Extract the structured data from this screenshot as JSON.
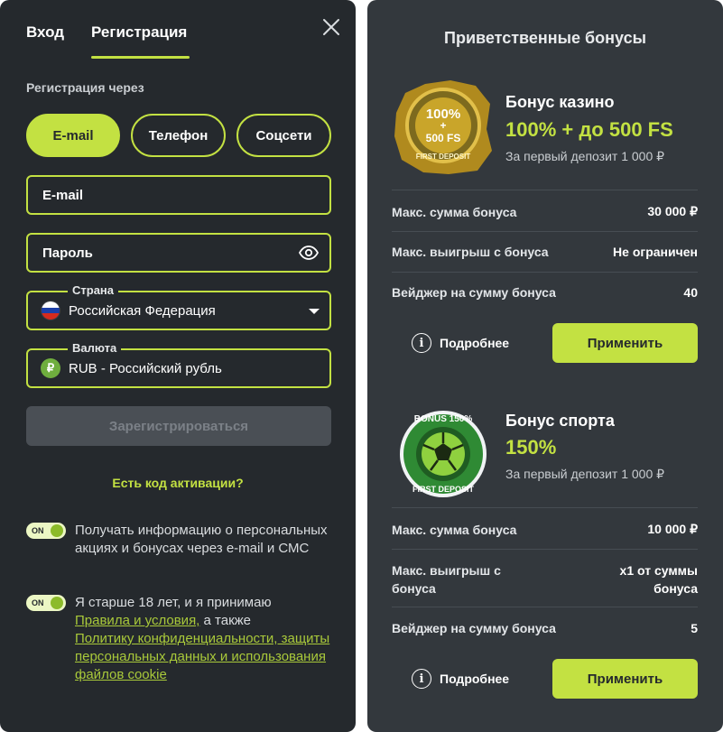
{
  "auth": {
    "tab_login": "Вход",
    "tab_register": "Регистрация",
    "register_via": "Регистрация через",
    "methods": {
      "email": "E-mail",
      "phone": "Телефон",
      "social": "Соцсети"
    },
    "email_placeholder": "E-mail",
    "password_placeholder": "Пароль",
    "country_label": "Страна",
    "country_value": "Российская Федерация",
    "currency_label": "Валюта",
    "currency_value": "RUB - Российский рубль",
    "currency_symbol": "₽",
    "register_button": "Зарегистрироваться",
    "activation_code": "Есть код активации?",
    "toggle_on": "ON",
    "consent_news": "Получать информацию о персональных акциях и бонусах через e-mail и СМС",
    "consent_age_prefix": "Я старше 18 лет, и я принимаю",
    "rules_link": "Правила и условия,",
    "also": " а также",
    "privacy_link": "Политику конфиденциальности, защиты персональных данных и использования файлов cookie"
  },
  "bonuses": {
    "title": "Приветственные бонусы",
    "casino": {
      "name": "Бонус казино",
      "value": "100% + до 500 FS",
      "subtitle": "За первый депозит 1 000 ₽",
      "badge_line1": "100%",
      "badge_line2": "+",
      "badge_line3": "500 FS",
      "badge_ribbon": "FIRST DEPOSIT",
      "rows": [
        {
          "label": "Макс. сумма бонуса",
          "value": "30 000 ₽"
        },
        {
          "label": "Макс. выигрыш с бонуса",
          "value": "Не ограничен"
        },
        {
          "label": "Вейджер на сумму бонуса",
          "value": "40"
        }
      ],
      "more": "Подробнее",
      "apply": "Применить"
    },
    "sport": {
      "name": "Бонус спорта",
      "value": "150%",
      "subtitle": "За первый депозит 1 000 ₽",
      "badge_top": "BONUS 150%",
      "badge_bottom": "FIRST DEPOSIT",
      "rows": [
        {
          "label": "Макс. сумма бонуса",
          "value": "10 000 ₽"
        },
        {
          "label": "Макс. выигрыш с бонуса",
          "value": "х1 от суммы бонуса"
        },
        {
          "label": "Вейджер на сумму бонуса",
          "value": "5"
        }
      ],
      "more": "Подробнее",
      "apply": "Применить"
    }
  },
  "colors": {
    "accent": "#c3e142",
    "panel_dark": "#25292d",
    "panel": "#33383d"
  }
}
